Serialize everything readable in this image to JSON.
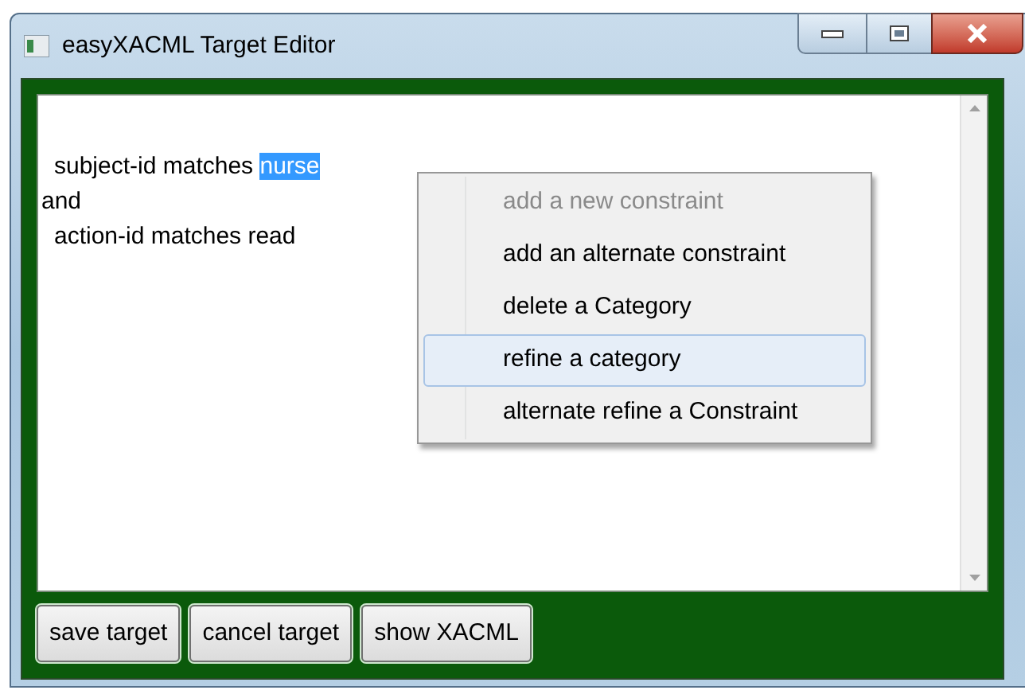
{
  "window": {
    "title": "easyXACML Target Editor"
  },
  "editor": {
    "lines": [
      {
        "indented": true,
        "segments": [
          {
            "text": "subject-id matches ",
            "selected": false
          },
          {
            "text": "nurse",
            "selected": true
          }
        ]
      },
      {
        "indented": false,
        "segments": [
          {
            "text": "and",
            "selected": false
          }
        ]
      },
      {
        "indented": true,
        "segments": [
          {
            "text": "action-id matches read",
            "selected": false
          }
        ]
      }
    ]
  },
  "context_menu": {
    "items": [
      {
        "label": "add a new constraint",
        "disabled": true,
        "selected": false
      },
      {
        "label": "add an alternate constraint",
        "disabled": false,
        "selected": false
      },
      {
        "label": "delete a Category",
        "disabled": false,
        "selected": false
      },
      {
        "label": "refine a category",
        "disabled": false,
        "selected": true
      },
      {
        "label": "alternate refine a Constraint",
        "disabled": false,
        "selected": false
      }
    ]
  },
  "buttons": [
    "save target",
    "cancel target",
    "show XACML"
  ]
}
